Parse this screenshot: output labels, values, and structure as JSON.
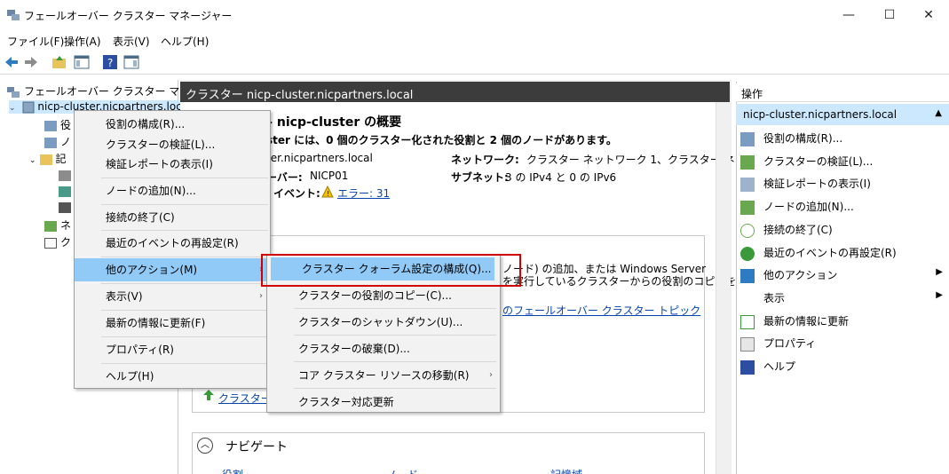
{
  "window": {
    "title": "フェールオーバー クラスター マネージャー",
    "min": "—",
    "max": "☐",
    "close": "✕"
  },
  "menubar": [
    "ファイル(F)",
    "操作(A)",
    "表示(V)",
    "ヘルプ(H)"
  ],
  "tree": {
    "root": "フェールオーバー クラスター マネージャー",
    "cluster": "nicp-cluster.nicpartners.local",
    "children": [
      "役",
      "ノ",
      "記",
      "ネ",
      "ク"
    ]
  },
  "center": {
    "header": "クラスター nicp-cluster.nicpartners.local",
    "summary_title": "– nicp-cluster の概要",
    "summary_desc": "ster には、0 個のクラスター化された役割と 2 個のノードがあります。",
    "name_val": "ter.nicpartners.local",
    "server_label": "ーバー:",
    "server_val": "NICP01",
    "event_label": "イベント:",
    "event_link": "エラー: 31",
    "network_label": "ネットワーク:",
    "network_val": "クラスター ネットワーク 1、クラスター ネット…",
    "subnet_label": "サブネット:",
    "subnet_val": "3 の IPv4 と 0 の IPv6",
    "config_text1": "ノード) の追加、または Windows Server",
    "config_text2": "を実行しているクラスターからの役割のコピーを",
    "topic_link": "のフェールオーバー クラスター トピック",
    "update_link": "クラスター対",
    "navigate_title": "ナビゲート",
    "nav_links": [
      "役割",
      "ノード",
      "記憶域"
    ]
  },
  "context_menu": {
    "items": [
      "役割の構成(R)...",
      "クラスターの検証(L)...",
      "検証レポートの表示(I)",
      "ノードの追加(N)...",
      "接続の終了(C)",
      "最近のイベントの再設定(R)",
      "他のアクション(M)",
      "表示(V)",
      "最新の情報に更新(F)",
      "プロパティ(R)",
      "ヘルプ(H)"
    ]
  },
  "submenu": {
    "items": [
      "クラスター クォーラム設定の構成(Q)...",
      "クラスターの役割のコピー(C)...",
      "クラスターのシャットダウン(U)...",
      "クラスターの破棄(D)...",
      "コア クラスター リソースの移動(R)",
      "クラスター対応更新"
    ]
  },
  "actions": {
    "header": "操作",
    "subheader": "nicp-cluster.nicpartners.local",
    "items": [
      "役割の構成(R)...",
      "クラスターの検証(L)...",
      "検証レポートの表示(I)",
      "ノードの追加(N)...",
      "接続の終了(C)",
      "最近のイベントの再設定(R)",
      "他のアクション",
      "表示",
      "最新の情報に更新",
      "プロパティ",
      "ヘルプ"
    ]
  },
  "colors": {
    "highlight": "#91c9f7",
    "red_outline": "#d00000",
    "header_dark": "#3c3c3c",
    "action_sub": "#cce8ff"
  }
}
